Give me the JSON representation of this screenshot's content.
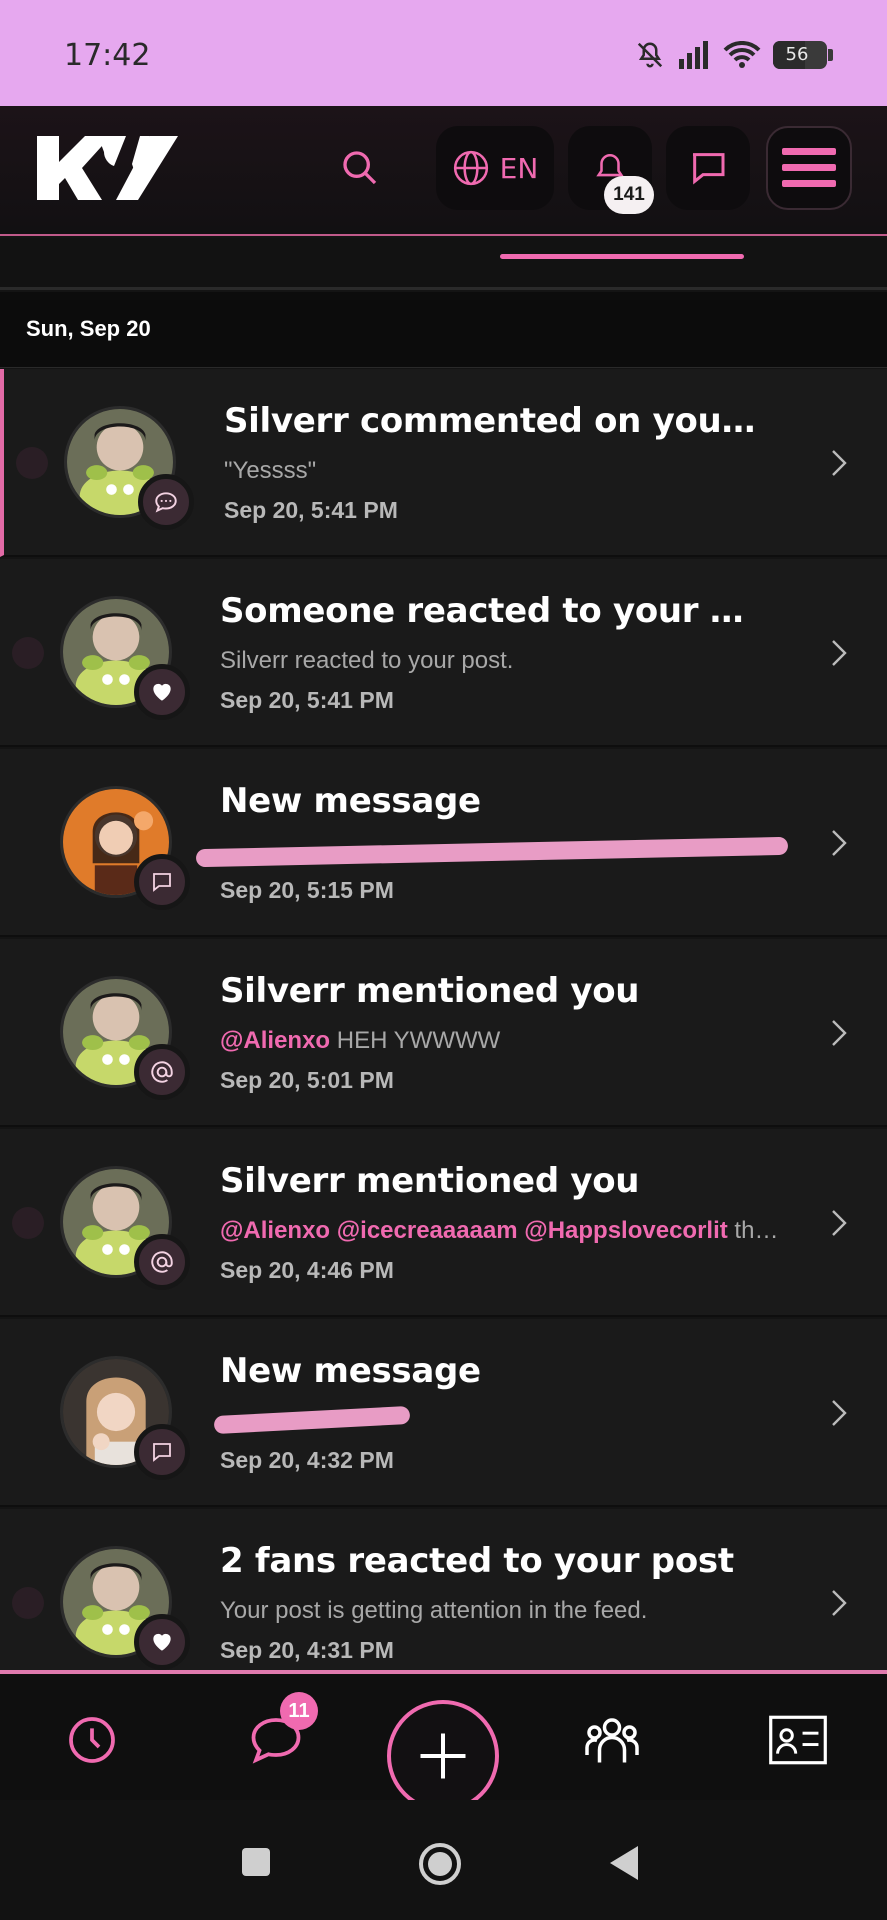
{
  "status_bar": {
    "time": "17:42",
    "battery": "56"
  },
  "header": {
    "logo_text": "KV",
    "language": "EN",
    "notification_count": "141"
  },
  "date_section": "Sun, Sep 20",
  "notifications": [
    {
      "title": "Silverr commented on your p...",
      "body": "\"Yessss\"",
      "time": "Sep 20, 5:41 PM",
      "type": "comment-icon"
    },
    {
      "title": "Someone reacted to your post",
      "body": "Silverr reacted to your post.",
      "time": "Sep 20, 5:41 PM",
      "type": "heart-icon"
    },
    {
      "title": "New message",
      "body": "",
      "time": "Sep 20, 5:15 PM",
      "type": "message-icon"
    },
    {
      "title": "Silverr mentioned you",
      "mention": "@Alienxo",
      "body": " HEH YWWWW",
      "time": "Sep 20, 5:01 PM",
      "type": "at-icon"
    },
    {
      "title": "Silverr mentioned you",
      "mention": "@Alienxo @icecreaaaaam @Happslovecorlit",
      "body": " they r ...",
      "time": "Sep 20, 4:46 PM",
      "type": "at-icon"
    },
    {
      "title": "New message",
      "body": "",
      "time": "Sep 20, 4:32 PM",
      "type": "message-icon"
    },
    {
      "title": "2 fans reacted to your post",
      "body": "Your post is getting attention in the feed.",
      "time": "Sep 20, 4:31 PM",
      "type": "heart-icon"
    }
  ],
  "bottom_nav": {
    "messages_badge": "11"
  },
  "colors": {
    "accent": "#f06ab0",
    "status_bar": "#e6a8ef",
    "background": "#141414"
  }
}
